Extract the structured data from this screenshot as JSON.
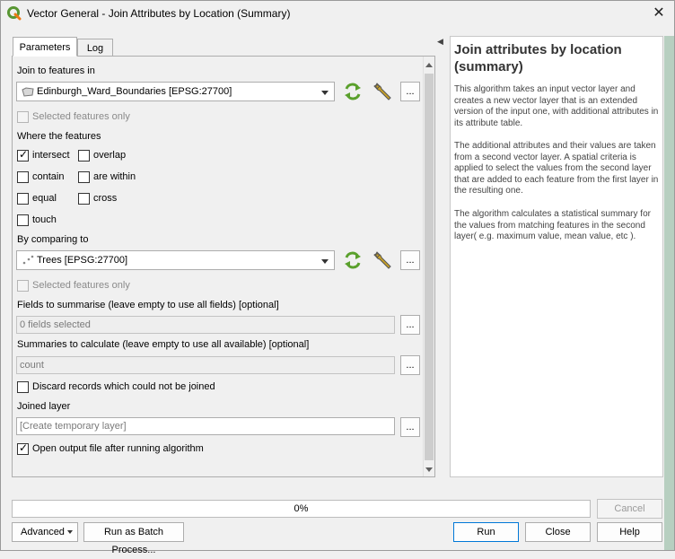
{
  "window": {
    "title": "Vector General - Join Attributes by Location (Summary)",
    "close_glyph": "✕"
  },
  "tabs": [
    {
      "label": "Parameters"
    },
    {
      "label": "Log"
    }
  ],
  "params": {
    "join_label": "Join to features in",
    "join_layer": "Edinburgh_Ward_Boundaries [EPSG:27700]",
    "selected_only_1": "Selected features only",
    "where_label": "Where the features",
    "predicates": {
      "intersect": "intersect",
      "overlap": "overlap",
      "contain": "contain",
      "are_within": "are within",
      "equal": "equal",
      "cross": "cross",
      "touch": "touch"
    },
    "predicates_checked": {
      "intersect": true,
      "overlap": false,
      "contain": false,
      "are_within": false,
      "equal": false,
      "cross": false,
      "touch": false
    },
    "comparing_label": "By comparing to",
    "comparing_layer": "Trees [EPSG:27700]",
    "selected_only_2": "Selected features only",
    "fields_label": "Fields to summarise (leave empty to use all fields) [optional]",
    "fields_value": "0 fields selected",
    "summaries_label": "Summaries to calculate (leave empty to use all available) [optional]",
    "summaries_value": "count",
    "discard_label": "Discard records which could not be joined",
    "joined_label": "Joined layer",
    "joined_placeholder": "[Create temporary layer]",
    "open_output_label": "Open output file after running algorithm",
    "ellipsis": "..."
  },
  "help": {
    "title": "Join attributes by location (summary)",
    "p1": "This algorithm takes an input vector layer and creates a new vector layer that is an extended version of the input one, with additional attributes in its attribute table.",
    "p2": "The additional attributes and their values are taken from a second vector layer. A spatial criteria is applied to select the values from the second layer that are added to each feature from the first layer in the resulting one.",
    "p3": "The algorithm calculates a statistical summary for the values from matching features in the second layer( e.g. maximum value, mean value, etc )."
  },
  "progress": {
    "text": "0%",
    "value": 0
  },
  "buttons": {
    "cancel": "Cancel",
    "advanced": "Advanced",
    "batch": "Run as Batch Process...",
    "run": "Run",
    "close": "Close",
    "help": "Help"
  },
  "colors": {
    "refresh_icon": "#5aa02c",
    "accent": "#0078d7"
  },
  "collapse_glyph": "◀"
}
